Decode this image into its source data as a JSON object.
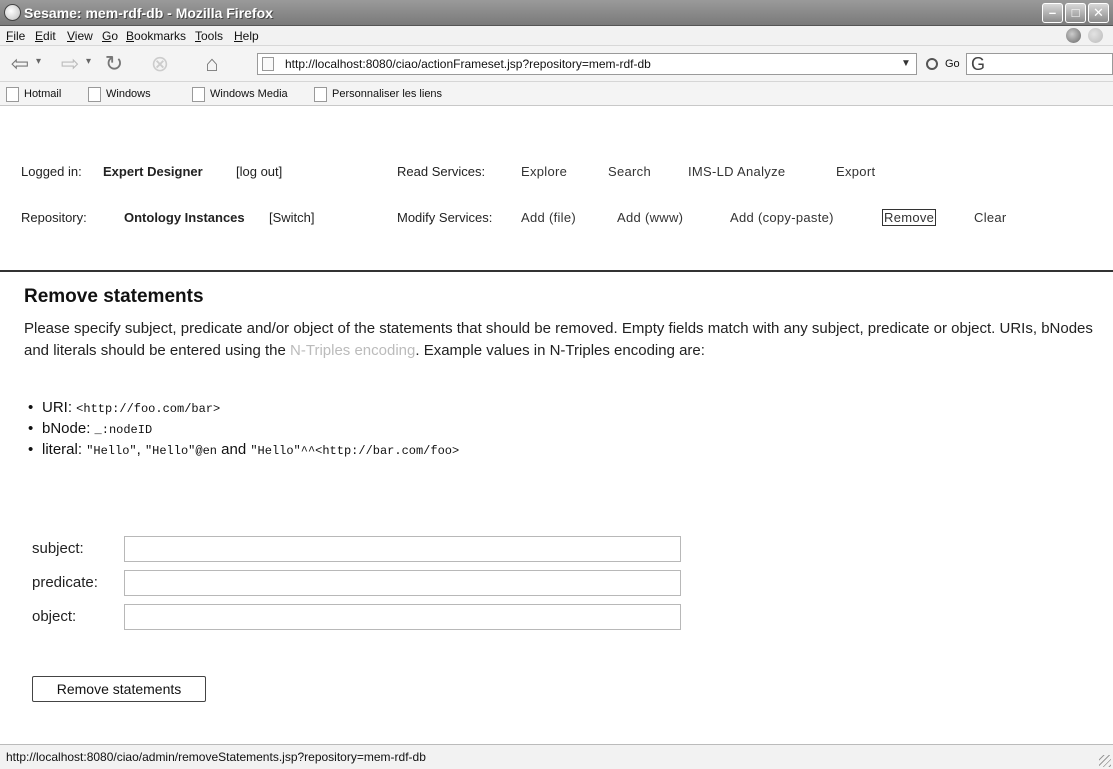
{
  "window": {
    "title": "Sesame: mem-rdf-db - Mozilla Firefox",
    "minimize": "–",
    "maximize": "□",
    "close": "✕"
  },
  "menubar": {
    "items": [
      "File",
      "Edit",
      "View",
      "Go",
      "Bookmarks",
      "Tools",
      "Help"
    ]
  },
  "navbar": {
    "url": "http://localhost:8080/ciao/actionFrameset.jsp?repository=mem-rdf-db",
    "go_label": "Go",
    "search_glyph": "G"
  },
  "bookmarks": {
    "items": [
      "Hotmail",
      "Windows",
      "Windows Media",
      "Personnaliser les liens"
    ]
  },
  "session": {
    "logged_in_label": "Logged in:",
    "user": "Expert Designer",
    "logout": "[log out]",
    "repository_label": "Repository:",
    "repository": "Ontology Instances",
    "switch": "[Switch]"
  },
  "read_services": {
    "label": "Read Services:",
    "links": [
      "Explore",
      "Search",
      "IMS-LD Analyze",
      "Export"
    ]
  },
  "modify_services": {
    "label": "Modify Services:",
    "links": [
      "Add (file)",
      "Add (www)",
      "Add (copy-paste)",
      "Remove",
      "Clear"
    ],
    "active": "Remove"
  },
  "main": {
    "title": "Remove statements",
    "intro_1": "Please specify subject, predicate and/or object of the statements that should be removed. Empty fields match with any subject, predicate or object. URIs, bNodes and literals should be entered using the ",
    "intro_link": "N-Triples encoding",
    "intro_2": ". Example values in N-Triples encoding are:",
    "examples": {
      "uri_label": "URI: ",
      "uri_value": "<http://foo.com/bar>",
      "bnode_label": "bNode: ",
      "bnode_value": "_:nodeID",
      "literal_label": "literal: ",
      "literal_v1": "\"Hello\"",
      "literal_sep1": ", ",
      "literal_v2": "\"Hello\"@en",
      "literal_and": " and ",
      "literal_v3": "\"Hello\"^^<http://bar.com/foo>"
    },
    "form": {
      "subject_label": "subject:",
      "subject_value": "",
      "predicate_label": "predicate:",
      "predicate_value": "",
      "object_label": "object:",
      "object_value": "",
      "submit": "Remove statements"
    }
  },
  "status": {
    "text": "http://localhost:8080/ciao/admin/removeStatements.jsp?repository=mem-rdf-db"
  }
}
